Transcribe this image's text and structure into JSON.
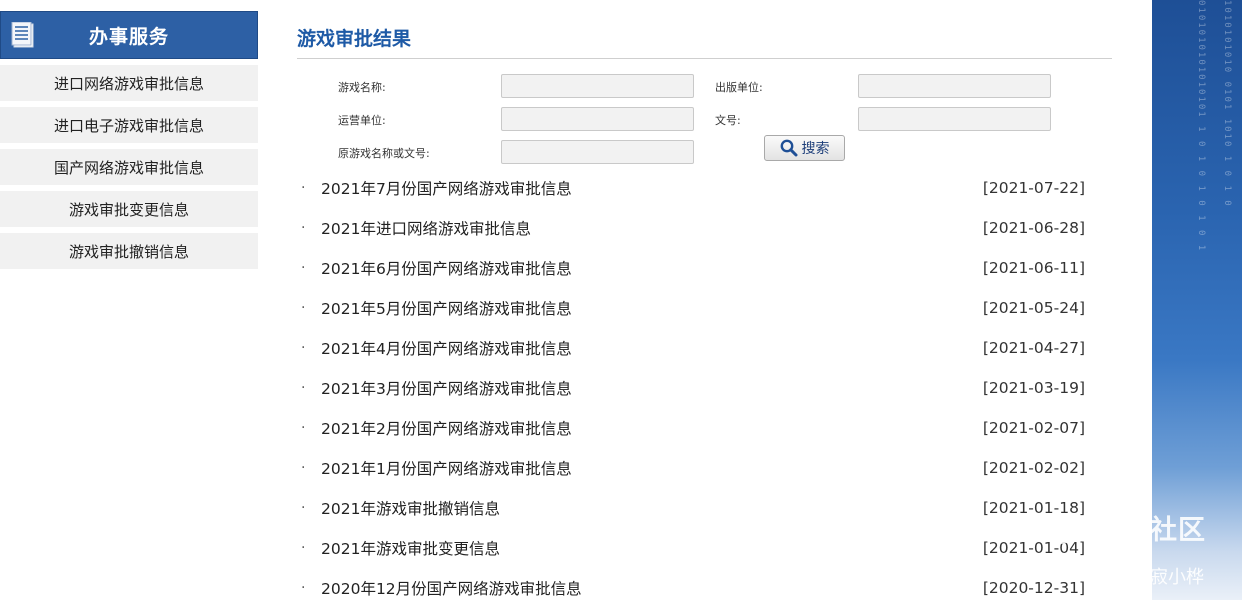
{
  "sidebar": {
    "title": "办事服务",
    "items": [
      {
        "label": "进口网络游戏审批信息"
      },
      {
        "label": "进口电子游戏审批信息"
      },
      {
        "label": "国产网络游戏审批信息"
      },
      {
        "label": "游戏审批变更信息"
      },
      {
        "label": "游戏审批撤销信息"
      }
    ]
  },
  "main": {
    "title": "游戏审批结果",
    "form": {
      "game_name_label": "游戏名称:",
      "publisher_label": "出版单位:",
      "operator_label": "运营单位:",
      "doc_no_label": "文号:",
      "original_label": "原游戏名称或文号:",
      "search_label": "搜索"
    },
    "list": [
      {
        "title": "2021年7月份国产网络游戏审批信息",
        "date": "[2021-07-22]"
      },
      {
        "title": "2021年进口网络游戏审批信息",
        "date": "[2021-06-28]"
      },
      {
        "title": "2021年6月份国产网络游戏审批信息",
        "date": "[2021-06-11]"
      },
      {
        "title": "2021年5月份国产网络游戏审批信息",
        "date": "[2021-05-24]"
      },
      {
        "title": "2021年4月份国产网络游戏审批信息",
        "date": "[2021-04-27]"
      },
      {
        "title": "2021年3月份国产网络游戏审批信息",
        "date": "[2021-03-19]"
      },
      {
        "title": "2021年2月份国产网络游戏审批信息",
        "date": "[2021-02-07]"
      },
      {
        "title": "2021年1月份国产网络游戏审批信息",
        "date": "[2021-02-02]"
      },
      {
        "title": "2021年游戏审批撤销信息",
        "date": "[2021-01-18]"
      },
      {
        "title": "2021年游戏审批变更信息",
        "date": "[2021-01-04]"
      },
      {
        "title": "2020年12月份国产网络游戏审批信息",
        "date": "[2020-12-31]"
      }
    ]
  },
  "watermark": {
    "site": "老虎社区",
    "user": "@寂小桦"
  },
  "colors": {
    "brand_blue": "#2d60a5",
    "title_blue": "#1e5aa6"
  }
}
